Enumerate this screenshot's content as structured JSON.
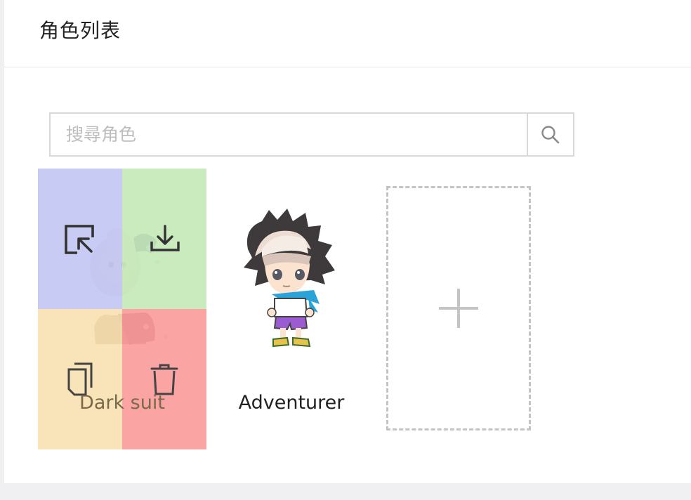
{
  "header": {
    "title": "角色列表"
  },
  "search": {
    "placeholder": "搜尋角色",
    "value": ""
  },
  "characters": [
    {
      "name": "Dark suit",
      "actions": {
        "select": "select-icon",
        "download": "download-icon",
        "copy": "copy-icon",
        "delete": "trash-icon"
      }
    },
    {
      "name": "Adventurer"
    }
  ],
  "add_card": {
    "icon": "plus-icon"
  },
  "colors": {
    "select_quadrant": "#b8bdf0",
    "download_quadrant": "#bee6b0",
    "copy_quadrant": "#f8deaa",
    "delete_quadrant": "#fa9494"
  }
}
